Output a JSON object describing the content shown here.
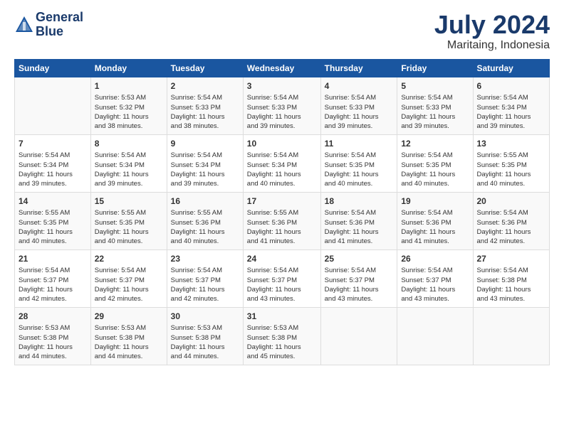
{
  "header": {
    "logo_line1": "General",
    "logo_line2": "Blue",
    "month_title": "July 2024",
    "location": "Maritaing, Indonesia"
  },
  "weekdays": [
    "Sunday",
    "Monday",
    "Tuesday",
    "Wednesday",
    "Thursday",
    "Friday",
    "Saturday"
  ],
  "weeks": [
    [
      {
        "day": "",
        "info": ""
      },
      {
        "day": "1",
        "info": "Sunrise: 5:53 AM\nSunset: 5:32 PM\nDaylight: 11 hours\nand 38 minutes."
      },
      {
        "day": "2",
        "info": "Sunrise: 5:54 AM\nSunset: 5:33 PM\nDaylight: 11 hours\nand 38 minutes."
      },
      {
        "day": "3",
        "info": "Sunrise: 5:54 AM\nSunset: 5:33 PM\nDaylight: 11 hours\nand 39 minutes."
      },
      {
        "day": "4",
        "info": "Sunrise: 5:54 AM\nSunset: 5:33 PM\nDaylight: 11 hours\nand 39 minutes."
      },
      {
        "day": "5",
        "info": "Sunrise: 5:54 AM\nSunset: 5:33 PM\nDaylight: 11 hours\nand 39 minutes."
      },
      {
        "day": "6",
        "info": "Sunrise: 5:54 AM\nSunset: 5:34 PM\nDaylight: 11 hours\nand 39 minutes."
      }
    ],
    [
      {
        "day": "7",
        "info": "Sunrise: 5:54 AM\nSunset: 5:34 PM\nDaylight: 11 hours\nand 39 minutes."
      },
      {
        "day": "8",
        "info": "Sunrise: 5:54 AM\nSunset: 5:34 PM\nDaylight: 11 hours\nand 39 minutes."
      },
      {
        "day": "9",
        "info": "Sunrise: 5:54 AM\nSunset: 5:34 PM\nDaylight: 11 hours\nand 39 minutes."
      },
      {
        "day": "10",
        "info": "Sunrise: 5:54 AM\nSunset: 5:34 PM\nDaylight: 11 hours\nand 40 minutes."
      },
      {
        "day": "11",
        "info": "Sunrise: 5:54 AM\nSunset: 5:35 PM\nDaylight: 11 hours\nand 40 minutes."
      },
      {
        "day": "12",
        "info": "Sunrise: 5:54 AM\nSunset: 5:35 PM\nDaylight: 11 hours\nand 40 minutes."
      },
      {
        "day": "13",
        "info": "Sunrise: 5:55 AM\nSunset: 5:35 PM\nDaylight: 11 hours\nand 40 minutes."
      }
    ],
    [
      {
        "day": "14",
        "info": "Sunrise: 5:55 AM\nSunset: 5:35 PM\nDaylight: 11 hours\nand 40 minutes."
      },
      {
        "day": "15",
        "info": "Sunrise: 5:55 AM\nSunset: 5:35 PM\nDaylight: 11 hours\nand 40 minutes."
      },
      {
        "day": "16",
        "info": "Sunrise: 5:55 AM\nSunset: 5:36 PM\nDaylight: 11 hours\nand 40 minutes."
      },
      {
        "day": "17",
        "info": "Sunrise: 5:55 AM\nSunset: 5:36 PM\nDaylight: 11 hours\nand 41 minutes."
      },
      {
        "day": "18",
        "info": "Sunrise: 5:54 AM\nSunset: 5:36 PM\nDaylight: 11 hours\nand 41 minutes."
      },
      {
        "day": "19",
        "info": "Sunrise: 5:54 AM\nSunset: 5:36 PM\nDaylight: 11 hours\nand 41 minutes."
      },
      {
        "day": "20",
        "info": "Sunrise: 5:54 AM\nSunset: 5:36 PM\nDaylight: 11 hours\nand 42 minutes."
      }
    ],
    [
      {
        "day": "21",
        "info": "Sunrise: 5:54 AM\nSunset: 5:37 PM\nDaylight: 11 hours\nand 42 minutes."
      },
      {
        "day": "22",
        "info": "Sunrise: 5:54 AM\nSunset: 5:37 PM\nDaylight: 11 hours\nand 42 minutes."
      },
      {
        "day": "23",
        "info": "Sunrise: 5:54 AM\nSunset: 5:37 PM\nDaylight: 11 hours\nand 42 minutes."
      },
      {
        "day": "24",
        "info": "Sunrise: 5:54 AM\nSunset: 5:37 PM\nDaylight: 11 hours\nand 43 minutes."
      },
      {
        "day": "25",
        "info": "Sunrise: 5:54 AM\nSunset: 5:37 PM\nDaylight: 11 hours\nand 43 minutes."
      },
      {
        "day": "26",
        "info": "Sunrise: 5:54 AM\nSunset: 5:37 PM\nDaylight: 11 hours\nand 43 minutes."
      },
      {
        "day": "27",
        "info": "Sunrise: 5:54 AM\nSunset: 5:38 PM\nDaylight: 11 hours\nand 43 minutes."
      }
    ],
    [
      {
        "day": "28",
        "info": "Sunrise: 5:53 AM\nSunset: 5:38 PM\nDaylight: 11 hours\nand 44 minutes."
      },
      {
        "day": "29",
        "info": "Sunrise: 5:53 AM\nSunset: 5:38 PM\nDaylight: 11 hours\nand 44 minutes."
      },
      {
        "day": "30",
        "info": "Sunrise: 5:53 AM\nSunset: 5:38 PM\nDaylight: 11 hours\nand 44 minutes."
      },
      {
        "day": "31",
        "info": "Sunrise: 5:53 AM\nSunset: 5:38 PM\nDaylight: 11 hours\nand 45 minutes."
      },
      {
        "day": "",
        "info": ""
      },
      {
        "day": "",
        "info": ""
      },
      {
        "day": "",
        "info": ""
      }
    ]
  ]
}
